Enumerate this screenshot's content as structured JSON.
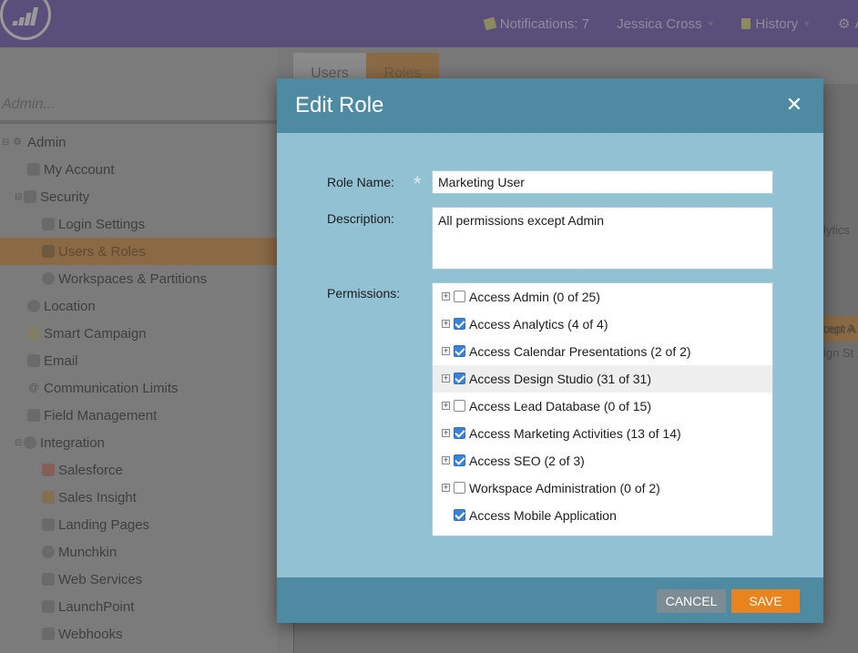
{
  "header": {
    "notifications": "Notifications: 7",
    "user": "Jessica Cross",
    "history": "History",
    "extra": "A"
  },
  "sidebar": {
    "search_placeholder": "Admin...",
    "items": [
      {
        "label": "Admin",
        "icon": "gear-icon"
      },
      {
        "label": "My Account",
        "icon": "person-icon"
      },
      {
        "label": "Security",
        "icon": "lock-icon"
      },
      {
        "label": "Login Settings",
        "icon": "key-icon"
      },
      {
        "label": "Users & Roles",
        "icon": "users-icon"
      },
      {
        "label": "Workspaces & Partitions",
        "icon": "globe-icon"
      },
      {
        "label": "Location",
        "icon": "location-icon"
      },
      {
        "label": "Smart Campaign",
        "icon": "bulb-icon"
      },
      {
        "label": "Email",
        "icon": "email-icon"
      },
      {
        "label": "Communication Limits",
        "icon": "at-icon"
      },
      {
        "label": "Field Management",
        "icon": "field-icon"
      },
      {
        "label": "Integration",
        "icon": "cloud-icon"
      },
      {
        "label": "Salesforce",
        "icon": "salesforce-icon"
      },
      {
        "label": "Sales Insight",
        "icon": "insight-icon"
      },
      {
        "label": "Landing Pages",
        "icon": "page-icon"
      },
      {
        "label": "Munchkin",
        "icon": "munchkin-icon"
      },
      {
        "label": "Web Services",
        "icon": "gears-icon"
      },
      {
        "label": "LaunchPoint",
        "icon": "rocket-icon"
      },
      {
        "label": "Webhooks",
        "icon": "hooks-icon"
      }
    ]
  },
  "tabs": {
    "users": "Users",
    "roles": "Roles"
  },
  "background": {
    "text1": "lytics",
    "text2": "cept A",
    "text3": "cept A",
    "text4": "ign St"
  },
  "modal": {
    "title": "Edit Role",
    "role_name_label": "Role Name:",
    "role_name_value": "Marketing User",
    "description_label": "Description:",
    "description_value": "All permissions except Admin",
    "permissions_label": "Permissions:",
    "permissions": [
      {
        "label": "Access Admin (0 of 25)",
        "checked": false,
        "expandable": true
      },
      {
        "label": "Access Analytics (4 of 4)",
        "checked": true,
        "expandable": true
      },
      {
        "label": "Access Calendar Presentations (2 of 2)",
        "checked": true,
        "expandable": true
      },
      {
        "label": "Access Design Studio (31 of 31)",
        "checked": true,
        "expandable": true
      },
      {
        "label": "Access Lead Database (0 of 15)",
        "checked": false,
        "expandable": true
      },
      {
        "label": "Access Marketing Activities (13 of 14)",
        "checked": true,
        "expandable": true
      },
      {
        "label": "Access SEO (2 of 3)",
        "checked": true,
        "expandable": true
      },
      {
        "label": "Workspace Administration (0 of 2)",
        "checked": false,
        "expandable": true
      },
      {
        "label": "Access Mobile Application",
        "checked": true,
        "expandable": false
      }
    ],
    "cancel_label": "CANCEL",
    "save_label": "SAVE"
  }
}
